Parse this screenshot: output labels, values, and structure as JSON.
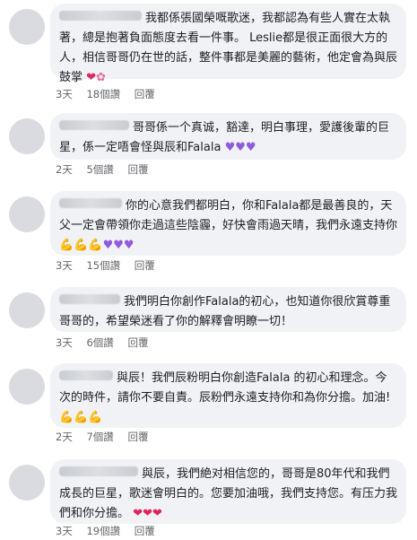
{
  "comments": [
    {
      "text": "我都係張國榮嘅歌迷，我都認為有些人實在太執著，總是抱著負面態度去看一件事。 Leslie都是很正面很大方的人，相信哥哥仍在世的話，整件事都是美麗的藝術，他定會為與辰鼓掌",
      "emojis": "♥🌷",
      "time": "3天",
      "views": "18個讚",
      "reply": "回覆"
    },
    {
      "text": "哥哥係一个真诚，豁達，明白事理，愛護後輩的巨星，係一定唔會怪與辰和Falala",
      "emojis": "♥♥♥",
      "time": "2天",
      "views": "5個讚",
      "reply": "回覆"
    },
    {
      "text": "你的心意我們都明白，你和Falala都是最善良的，天父一定會帶領你走過這些陰霾，好快會雨過天晴，我們永遠支持你",
      "emojis": "💪💪💪♥♥♥",
      "time": "3天",
      "views": "15個讚",
      "reply": "回覆"
    },
    {
      "text": "我們明白你創作Falala的初心，也知道你很欣賞尊重哥哥的，希望榮迷看了你的解釋會明瞭一切！",
      "emojis": "",
      "time": "3天",
      "views": "6個讚",
      "reply": "回覆"
    },
    {
      "text": "與辰！我們辰粉明白你創造Falala 的初心和理念。今次的時件，請你不要自責。辰粉們永遠支持你和為你分擔。加油!",
      "emojis": "💪💪💪",
      "time": "2天",
      "views": "7個讚",
      "reply": "回覆"
    },
    {
      "text": "與辰，我們絶对相信您的，哥哥是80年代和我們成長的巨星，歌迷會明白的。您要加油哦，我們支持您。有压力我們和你分擔。",
      "emojis": "♥♥♥",
      "time": "3天",
      "views": "19個讚",
      "reply": "回覆"
    }
  ]
}
